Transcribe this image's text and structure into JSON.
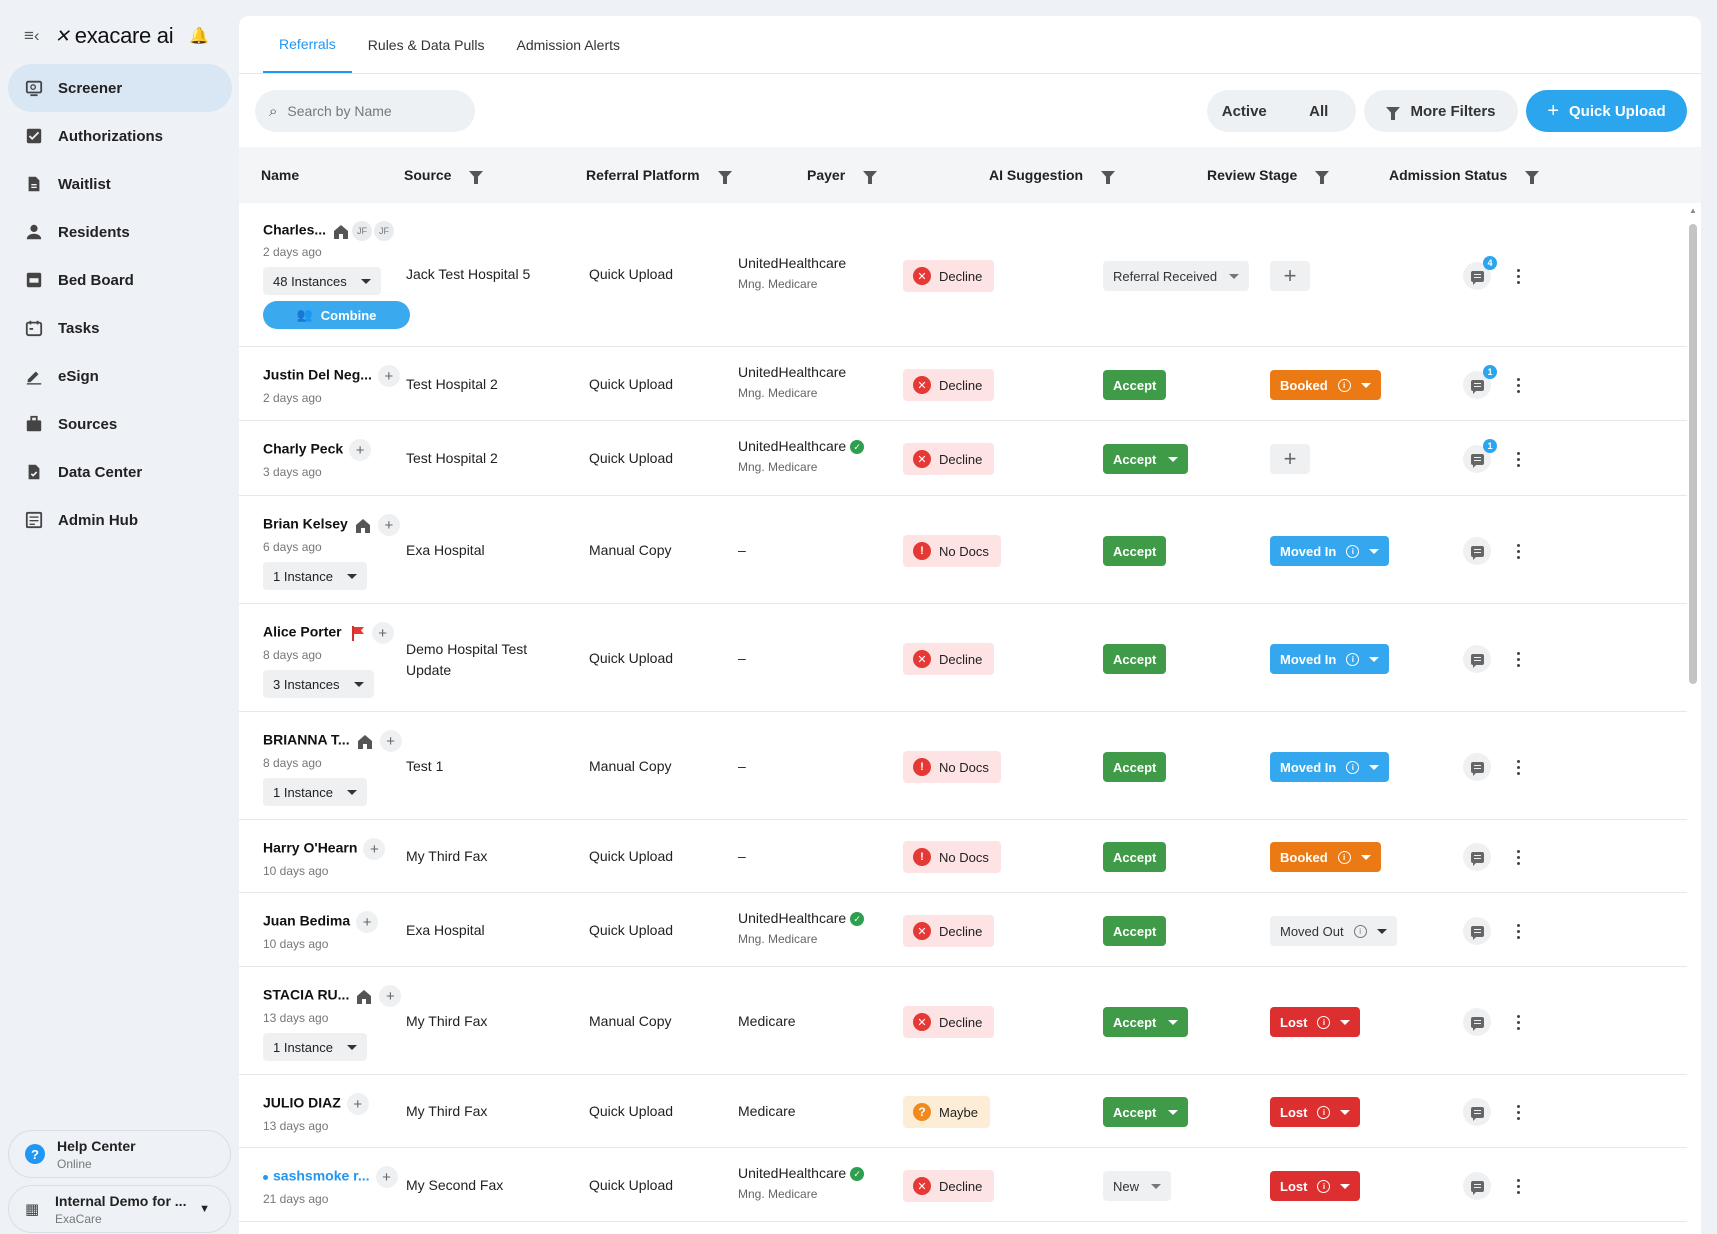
{
  "brand": {
    "name": "exacare ai"
  },
  "sidebar": {
    "items": [
      {
        "label": "Screener",
        "icon": "screener-icon",
        "active": true
      },
      {
        "label": "Authorizations",
        "icon": "authorizations-icon"
      },
      {
        "label": "Waitlist",
        "icon": "waitlist-icon"
      },
      {
        "label": "Residents",
        "icon": "residents-icon"
      },
      {
        "label": "Bed Board",
        "icon": "bed-board-icon"
      },
      {
        "label": "Tasks",
        "icon": "tasks-icon"
      },
      {
        "label": "eSign",
        "icon": "esign-icon"
      },
      {
        "label": "Sources",
        "icon": "sources-icon"
      },
      {
        "label": "Data Center",
        "icon": "data-center-icon"
      },
      {
        "label": "Admin Hub",
        "icon": "admin-hub-icon"
      }
    ],
    "help": {
      "title": "Help Center",
      "status": "Online"
    },
    "org": {
      "title": "Internal Demo for ...",
      "subtitle": "ExaCare"
    }
  },
  "tabs": [
    {
      "label": "Referrals",
      "active": true
    },
    {
      "label": "Rules & Data Pulls"
    },
    {
      "label": "Admission Alerts"
    }
  ],
  "toolbar": {
    "search_placeholder": "Search by Name",
    "seg_active": "Active",
    "seg_all": "All",
    "more_filters": "More Filters",
    "quick_upload": "Quick Upload"
  },
  "columns": {
    "name": "Name",
    "source": "Source",
    "platform": "Referral Platform",
    "payer": "Payer",
    "ai": "AI Suggestion",
    "review": "Review Stage",
    "admission": "Admission Status"
  },
  "colors": {
    "accent": "#2196f3",
    "accept": "#3f9b48",
    "booked": "#ec7a14",
    "moved_in": "#35a7ee",
    "lost": "#dd2f2f"
  },
  "rows": [
    {
      "name": "Charles...",
      "ago": "2 days ago",
      "initials": [
        "JF",
        "JF"
      ],
      "instances": "48 Instances",
      "combine": "Combine",
      "source": "Jack Test Hospital 5",
      "platform": "Quick Upload",
      "payer": "UnitedHealthcare",
      "payer_sub": "Mng. Medicare",
      "ai": "Decline",
      "review": "Referral Received",
      "admission": "",
      "comments": "4"
    },
    {
      "name": "Justin Del Neg...",
      "ago": "2 days ago",
      "source": "Test Hospital 2",
      "platform": "Quick Upload",
      "payer": "UnitedHealthcare",
      "payer_sub": "Mng. Medicare",
      "ai": "Decline",
      "review": "Accept",
      "admission": "Booked",
      "comments": "1"
    },
    {
      "name": "Charly Peck",
      "ago": "3 days ago",
      "source": "Test Hospital 2",
      "platform": "Quick Upload",
      "payer": "UnitedHealthcare",
      "payer_sub": "Mng. Medicare",
      "ai": "Decline",
      "review": "Accept",
      "admission": "",
      "comments": "1"
    },
    {
      "name": "Brian Kelsey",
      "ago": "6 days ago",
      "instances": "1 Instance",
      "source": "Exa Hospital",
      "platform": "Manual Copy",
      "payer": "–",
      "ai": "No Docs",
      "review": "Accept",
      "admission": "Moved In"
    },
    {
      "name": "Alice Porter",
      "ago": "8 days ago",
      "instances": "3 Instances",
      "source": "Demo Hospital Test Update",
      "platform": "Quick Upload",
      "payer": "–",
      "ai": "Decline",
      "review": "Accept",
      "admission": "Moved In"
    },
    {
      "name": "BRIANNA T...",
      "ago": "8 days ago",
      "instances": "1 Instance",
      "source": "Test 1",
      "platform": "Manual Copy",
      "payer": "–",
      "ai": "No Docs",
      "review": "Accept",
      "admission": "Moved In"
    },
    {
      "name": "Harry O'Hearn",
      "ago": "10 days ago",
      "source": "My Third Fax",
      "platform": "Quick Upload",
      "payer": "–",
      "ai": "No Docs",
      "review": "Accept",
      "admission": "Booked"
    },
    {
      "name": "Juan Bedima",
      "ago": "10 days ago",
      "source": "Exa Hospital",
      "platform": "Quick Upload",
      "payer": "UnitedHealthcare",
      "payer_sub": "Mng. Medicare",
      "ai": "Decline",
      "review": "Accept",
      "admission": "Moved Out"
    },
    {
      "name": "STACIA RU...",
      "ago": "13 days ago",
      "instances": "1 Instance",
      "source": "My Third Fax",
      "platform": "Manual Copy",
      "payer": "Medicare",
      "ai": "Decline",
      "review": "Accept",
      "admission": "Lost"
    },
    {
      "name": "JULIO DIAZ",
      "ago": "13 days ago",
      "source": "My Third Fax",
      "platform": "Quick Upload",
      "payer": "Medicare",
      "ai": "Maybe",
      "review": "Accept",
      "admission": "Lost"
    },
    {
      "name": "sashsmoke r...",
      "ago": "21 days ago",
      "source": "My Second Fax",
      "platform": "Quick Upload",
      "payer": "UnitedHealthcare",
      "payer_sub": "Mng. Medicare",
      "ai": "Decline",
      "review": "New",
      "admission": "Lost"
    }
  ]
}
